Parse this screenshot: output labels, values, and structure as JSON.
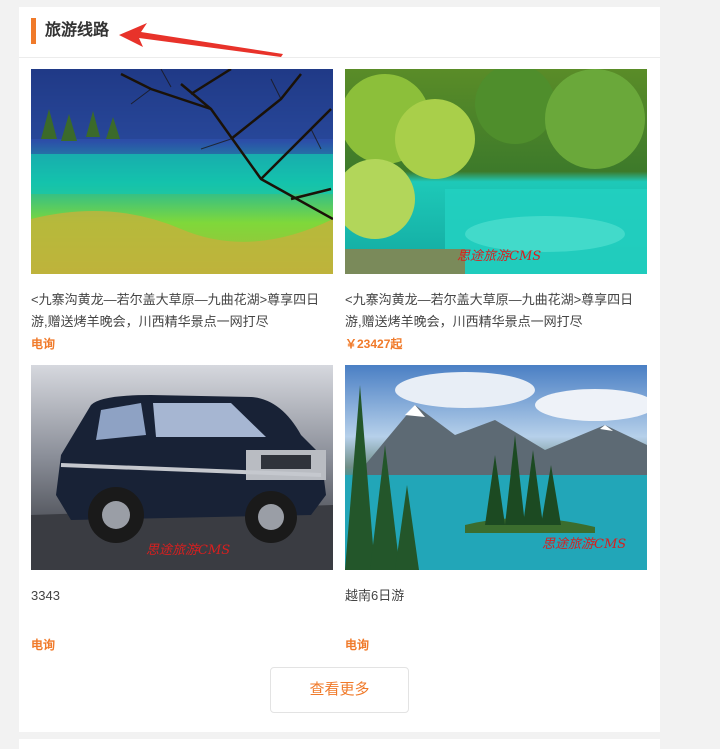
{
  "section": {
    "title": "旅游线路"
  },
  "items": [
    {
      "title": "<九寨沟黄龙—若尔盖大草原—九曲花湖>尊享四日游,赠送烤羊晚会，川西精华景点一网打尽",
      "price": "电询",
      "watermark": ""
    },
    {
      "title": "<九寨沟黄龙—若尔盖大草原—九曲花湖>尊享四日游,赠送烤羊晚会，川西精华景点一网打尽",
      "price": "￥23427起",
      "watermark": "思途旅游CMS"
    },
    {
      "title": "3343",
      "price": "电询",
      "watermark": "思途旅游CMS"
    },
    {
      "title": "越南6日游",
      "price": "电询",
      "watermark": "思途旅游CMS"
    }
  ],
  "more_button": {
    "label": "查看更多"
  },
  "colors": {
    "accent": "#f07a2a",
    "arrow": "#e8322a",
    "watermark": "#d81f1f"
  }
}
